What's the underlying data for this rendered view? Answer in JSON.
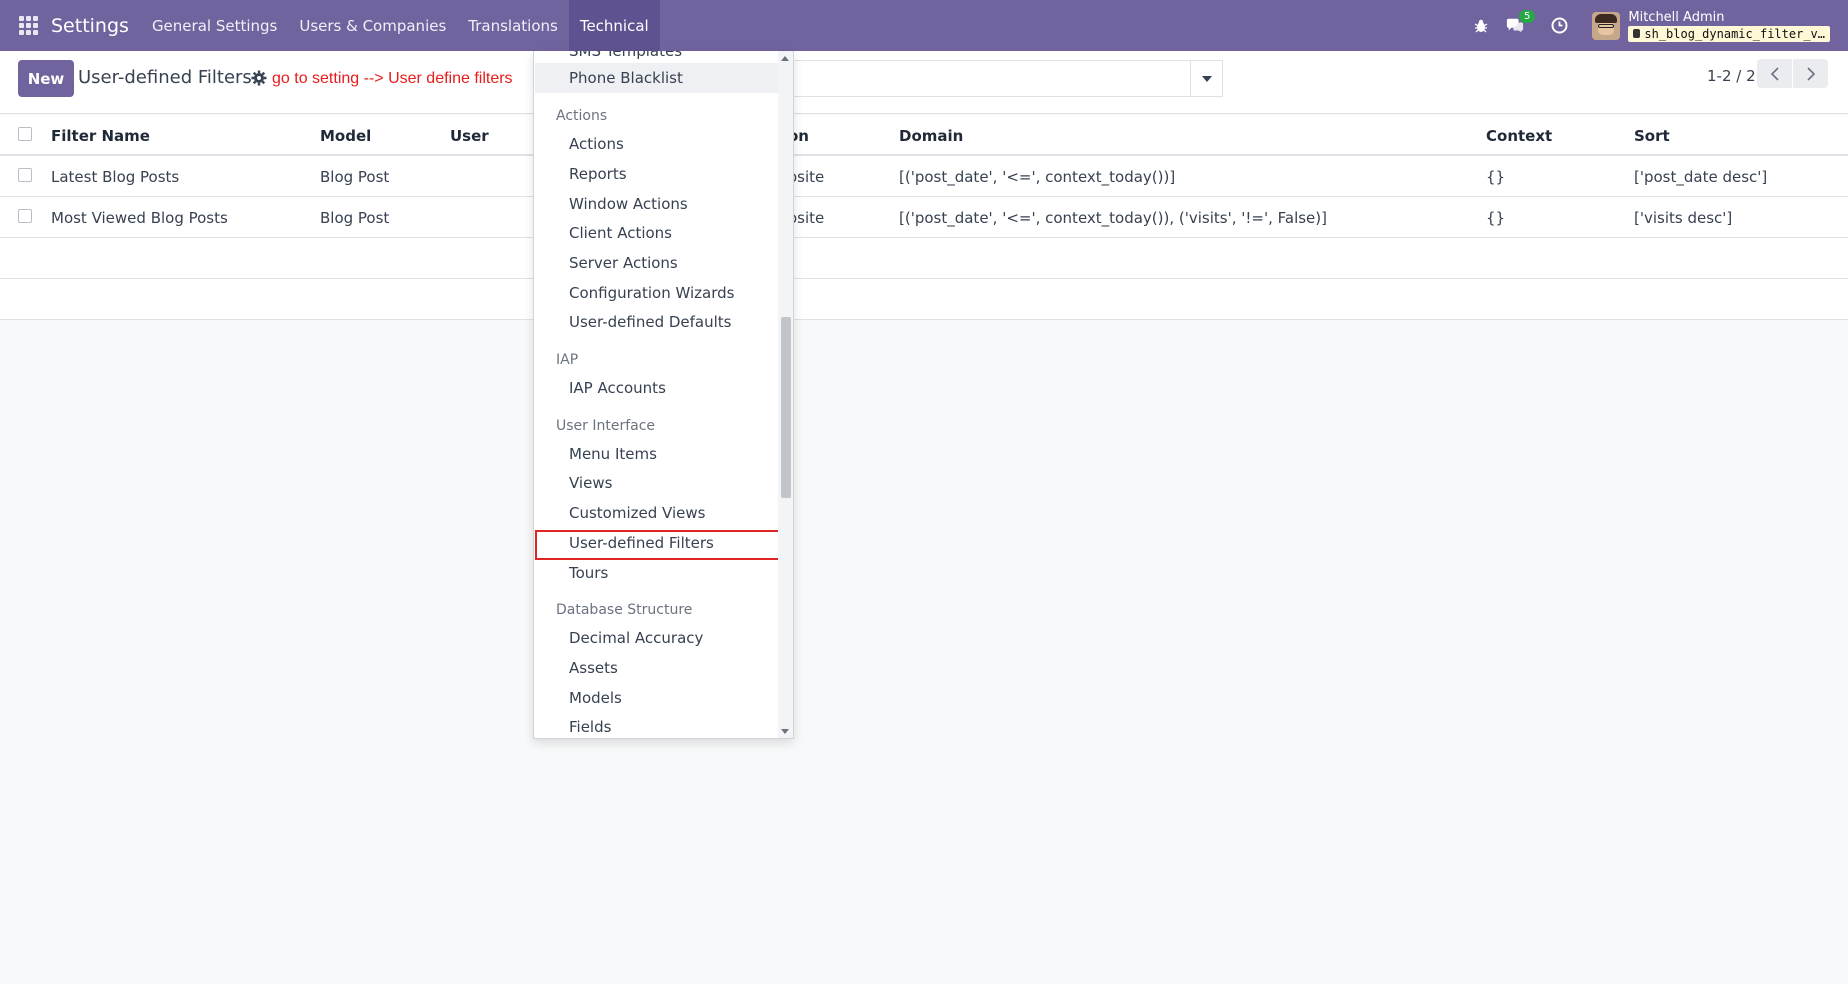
{
  "navbar": {
    "brand": "Settings",
    "menu": [
      "General Settings",
      "Users & Companies",
      "Translations",
      "Technical"
    ],
    "active_menu": "Technical",
    "messages_badge": "5",
    "user_name": "Mitchell Admin",
    "database": "sh_blog_dynamic_filter_v…",
    "bg_color": "#71639e"
  },
  "control_panel": {
    "new_label": "New",
    "title": "User-defined Filters",
    "annotation": "go to setting --> User define filters",
    "pager": "1-2 / 2"
  },
  "table": {
    "columns": [
      "Filter Name",
      "Model",
      "User",
      "on",
      "Domain",
      "Context",
      "Sort"
    ],
    "rows": [
      {
        "name": "Latest Blog Posts",
        "model": "Blog Post",
        "user": "",
        "action": "osite",
        "domain": "[('post_date', '<=', context_today())]",
        "context": "{}",
        "sort": "['post_date desc']"
      },
      {
        "name": "Most Viewed Blog Posts",
        "model": "Blog Post",
        "user": "",
        "action": "osite",
        "domain": "[('post_date', '<=', context_today()), ('visits', '!=', False)]",
        "context": "{}",
        "sort": "['visits desc']"
      }
    ]
  },
  "dropdown": {
    "partial_top": "SMS Templates",
    "phone_blacklist": "Phone Blacklist",
    "sections": [
      {
        "title": "Actions",
        "items": [
          "Actions",
          "Reports",
          "Window Actions",
          "Client Actions",
          "Server Actions",
          "Configuration Wizards",
          "User-defined Defaults"
        ]
      },
      {
        "title": "IAP",
        "items": [
          "IAP Accounts"
        ]
      },
      {
        "title": "User Interface",
        "items": [
          "Menu Items",
          "Views",
          "Customized Views",
          "User-defined Filters",
          "Tours"
        ]
      },
      {
        "title": "Database Structure",
        "items": [
          "Decimal Accuracy",
          "Assets",
          "Models",
          "Fields"
        ]
      }
    ],
    "highlighted_item": "User-defined Filters"
  }
}
